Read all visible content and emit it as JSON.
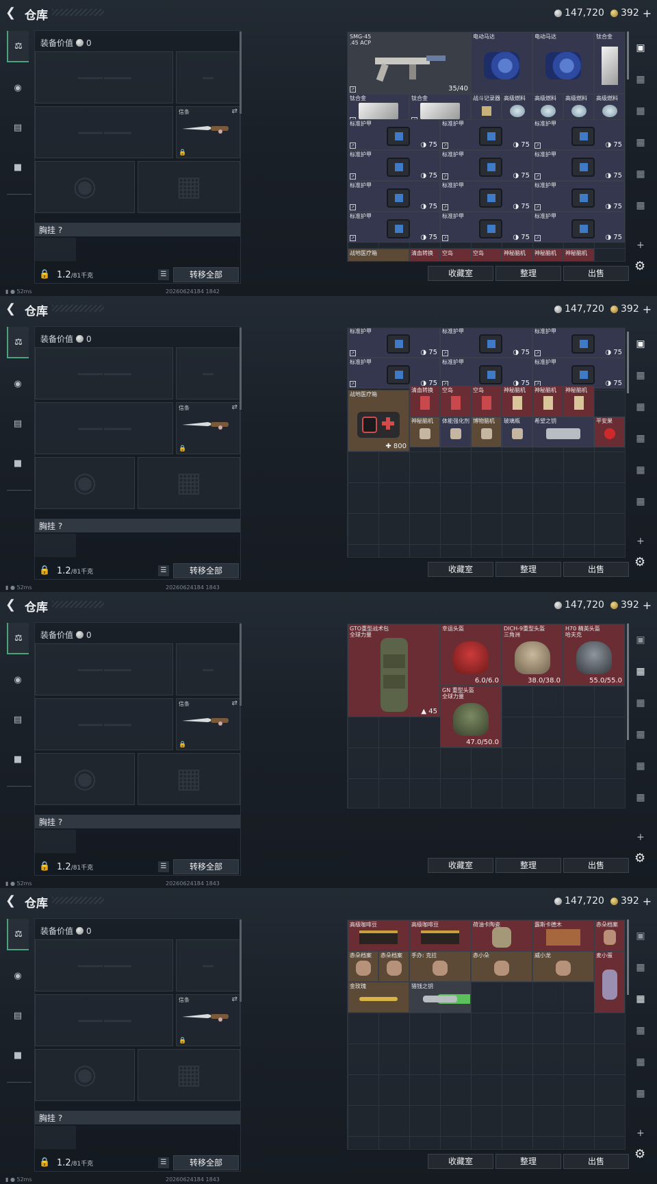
{
  "app": {
    "title": "仓库",
    "silver": "147,720",
    "gold": "392",
    "gold_plus": "+",
    "gear_value_label": "装备价值",
    "gear_value": "0",
    "knife_label": "信条",
    "chest_label": "胸挂 ?",
    "weight": "1.2",
    "weight_max": "/81千克",
    "transfer_all": "转移全部",
    "btn_fav": "收藏室",
    "btn_sort": "整理",
    "btn_sell": "出售",
    "ping": "52ms",
    "ids": [
      "2026062418421842",
      "2026062418421843",
      "2026062418421843",
      "2026062418421843"
    ],
    "id_display": [
      "20260624184?1842",
      "2026062418421843"
    ],
    "icons": {
      "back": "back-arrow-icon",
      "rail": [
        "pistol-icon",
        "helmet-icon",
        "clipboard-icon",
        "briefcase-icon"
      ],
      "right_rail": [
        "stash-main-icon",
        "stash-page-icon",
        "settings-gear-icon",
        "plus-icon"
      ]
    },
    "colors": {
      "accent": "#4aa37a",
      "cell_red": "#6a2d33",
      "cell_gold": "#5c4a36",
      "cell_blue": "#34374e"
    }
  },
  "status_ids": [
    "20260624184 1842",
    "20260624184 1843",
    "20260624184 1843",
    "20260624184 1843"
  ],
  "stash1": {
    "smg": {
      "name": "SMG-45",
      "sub": ".45 ACP",
      "qty": "35/40"
    },
    "motor": "电动马达",
    "alloy": "钛合金",
    "recorder": "战斗记录器",
    "fuel": "高级燃料",
    "armor": "标准护甲",
    "armor_val": "75",
    "medbox": "战地医疗箱",
    "bottom_row": [
      "战地医疗箱",
      "清血转换",
      "空岛",
      "空岛",
      "神秘脑机",
      "神秘脑机",
      "神秘脑机"
    ]
  },
  "stash2": {
    "armor": "标准护甲",
    "armor_val": "75",
    "medbox": "战地医疗箱",
    "medbox_val": "800",
    "row": [
      "清血转换",
      "空岛",
      "空岛",
      "神秘脑机",
      "神秘脑机",
      "神秘脑机"
    ],
    "row2": [
      "神秘脑机",
      "体能强化剂",
      "博物脑机",
      "玻璃瓶",
      "希望之钥",
      "平安果"
    ]
  },
  "stash3": {
    "bag": {
      "name": "GTO重型战术包",
      "sub": "全球力量",
      "qty": "45"
    },
    "h1": {
      "name": "幸运头盔",
      "qty": "6.0/6.0"
    },
    "h2": {
      "name": "DICH-9重型头盔",
      "sub": "三角洲",
      "qty": "38.0/38.0"
    },
    "h3": {
      "name": "H70 精英头盔",
      "sub": "哈夫克",
      "qty": "55.0/55.0"
    },
    "h4": {
      "name": "GN 重型头盔",
      "sub": "全球力量",
      "qty": "47.0/50.0"
    }
  },
  "stash4": {
    "coffee": "高级咖啡豆",
    "tea": "荷油卡陶瓷",
    "leather": "露斯卡德木",
    "file": "赤朵档案",
    "r2": [
      "赤朵档案",
      "赤朵档案",
      "手办: 克拉",
      "赤小朵",
      "威小龙",
      "麦小蛋"
    ],
    "rose": "金玫瑰",
    "key": "猎钱之钥"
  }
}
